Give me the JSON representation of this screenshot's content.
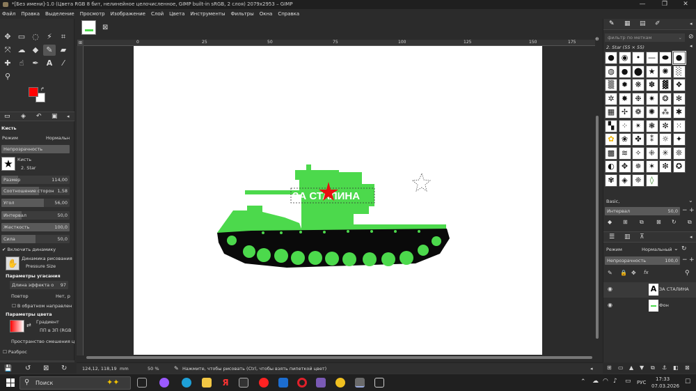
{
  "window": {
    "title": "*[Без имени]-1.0 (Цвета RGB 8 бит, нелинейное целочисленное, GIMP built-in sRGB, 2 слоя) 2079x2953 – GIMP",
    "controls": [
      "—",
      "❐",
      "✕"
    ]
  },
  "menu": [
    "Файл",
    "Правка",
    "Выделение",
    "Просмотр",
    "Изображение",
    "Слой",
    "Цвета",
    "Инструменты",
    "Фильтры",
    "Окна",
    "Справка"
  ],
  "colors": {
    "fg": "#ff0000",
    "bg": "#ffffff",
    "tank_green": "#4cd94c",
    "tank_black": "#0a0a0a",
    "star_red": "#e81010"
  },
  "tool_options": {
    "title": "Кисть",
    "mode_label": "Режим",
    "mode_value": "Нормальн",
    "opacity_label": "Непрозрачность",
    "brush_label": "Кисть",
    "brush_name": "2. Star",
    "size_label": "Размер",
    "size_value": "114,00",
    "aspect_label": "Соотношение сторон",
    "aspect_value": "1,58",
    "angle_label": "Угол",
    "angle_value": "56,00",
    "spacing_label": "Интервал",
    "spacing_value": "50,0",
    "hardness_label": "Жесткость",
    "hardness_value": "100,0",
    "force_label": "Сила",
    "force_value": "50,0",
    "dynamics_label": "Включить динамику",
    "dynamics_title": "Динамика рисования",
    "dynamics_value": "Pressure Size",
    "fade_header": "Параметры угасания",
    "fade_length_label": "Длина эффекта о",
    "fade_length_value": "97",
    "repeat_label": "Повтор",
    "repeat_value": "Нет, р",
    "reverse_label": "В обратном направлен",
    "color_header": "Параметры цвета",
    "gradient_label": "Градиент",
    "gradient_value": "ПП в ЗП (RGB",
    "blend_space_label": "Пространство смешения ц",
    "scatter_label": "Разброс"
  },
  "image_tab": {
    "close": "⊠"
  },
  "ruler": {
    "ticks": [
      "0",
      "25",
      "50",
      "75",
      "100",
      "125",
      "150",
      "175"
    ]
  },
  "canvas": {
    "tank_text": "ЗА СТАЛИНА"
  },
  "brushes_panel": {
    "filter_placeholder": "фильтр по меткам",
    "current_brush": "2. Star (55 × 55)",
    "preset": "Basic,",
    "spacing_label": "Интервал",
    "spacing_value": "50,0"
  },
  "layers_panel": {
    "mode_label": "Режим",
    "mode_value": "Нормальный",
    "opacity_label": "Непрозрачность",
    "opacity_value": "100,0",
    "layers": [
      {
        "name": "ЗА СТАЛИНА",
        "type": "text"
      },
      {
        "name": "Фон",
        "type": "image"
      }
    ]
  },
  "statusbar": {
    "coords": "124,12, 118,19",
    "unit": "mm",
    "zoom": "50 %",
    "message": "Нажмите, чтобы рисовать (Ctrl, чтобы взять пипеткой цвет)"
  },
  "taskbar": {
    "search_placeholder": "Поиск",
    "lang": "РУС",
    "time": "17:33",
    "date": "07.03.2026"
  }
}
